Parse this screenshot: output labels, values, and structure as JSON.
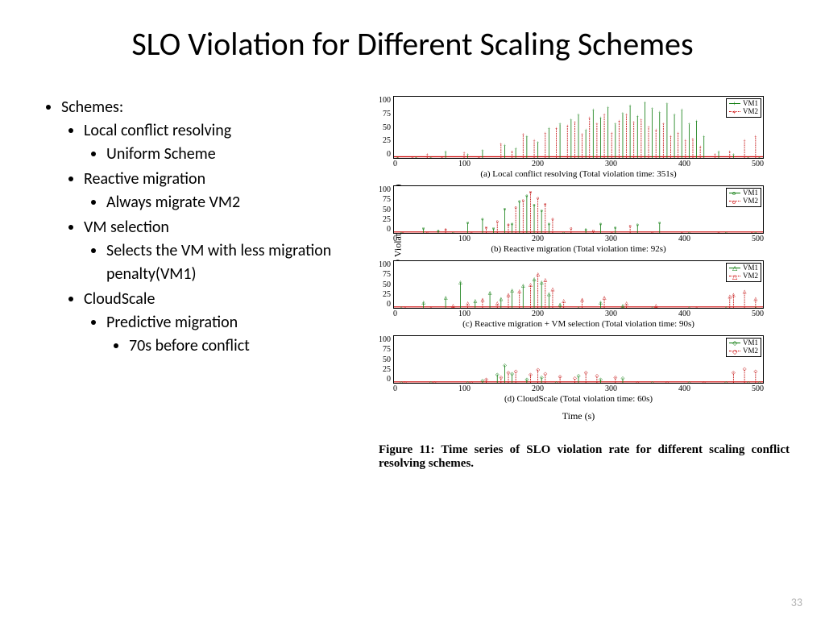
{
  "title": "SLO Violation for Different Scaling Schemes",
  "bullets": {
    "schemes_label": "Schemes:",
    "b1": "Local conflict resolving",
    "b1a": "Uniform Scheme",
    "b2": "Reactive migration",
    "b2a": "Always migrate VM2",
    "b3": "VM selection",
    "b3a": "Selects the VM with less migration penalty(VM1)",
    "b4": "CloudScale",
    "b4a": "Predictive migration",
    "b4a1": "70s before conflict"
  },
  "page_number": "33",
  "figure_caption": "Figure 11: Time series of SLO violation rate for different scaling conflict resolving schemes.",
  "axis": {
    "ylabel": "SLO Violation Rate (%)",
    "xlabel": "Time (s)",
    "xticks": [
      "0",
      "100",
      "200",
      "300",
      "400",
      "500"
    ]
  },
  "legend_labels": {
    "vm1": "VM1",
    "vm2": "VM2"
  },
  "chart_data": [
    {
      "id": "a",
      "height": "big",
      "caption": "(a) Local conflict resolving (Total violation time: 351s)",
      "yticks": [
        "100",
        "75",
        "50",
        "25",
        "0"
      ],
      "ylim": [
        0,
        100
      ],
      "xlim": [
        0,
        500
      ],
      "marker": {
        "vm1": "+",
        "vm2": "+"
      },
      "color": {
        "vm1": "#0a7a0a",
        "vm2": "#c00000"
      },
      "series": {
        "vm1": {
          "x": [
            5,
            30,
            50,
            70,
            100,
            120,
            150,
            165,
            180,
            195,
            210,
            225,
            240,
            250,
            260,
            270,
            280,
            290,
            300,
            310,
            320,
            330,
            340,
            350,
            360,
            370,
            380,
            390,
            400,
            410,
            420,
            440,
            460,
            480,
            495
          ],
          "y": [
            0,
            0,
            0,
            10,
            5,
            12,
            20,
            15,
            35,
            25,
            48,
            55,
            62,
            70,
            45,
            78,
            65,
            82,
            55,
            72,
            85,
            68,
            90,
            80,
            74,
            88,
            70,
            78,
            55,
            60,
            35,
            10,
            5,
            0,
            0
          ]
        },
        "vm2": {
          "x": [
            5,
            25,
            45,
            65,
            95,
            115,
            145,
            160,
            175,
            190,
            205,
            220,
            235,
            245,
            255,
            265,
            275,
            285,
            295,
            305,
            315,
            325,
            335,
            345,
            355,
            365,
            375,
            385,
            395,
            405,
            415,
            435,
            455,
            475,
            490
          ],
          "y": [
            0,
            0,
            5,
            0,
            8,
            0,
            22,
            10,
            38,
            28,
            40,
            48,
            52,
            58,
            38,
            65,
            55,
            70,
            40,
            60,
            70,
            58,
            62,
            50,
            45,
            55,
            35,
            40,
            28,
            30,
            18,
            5,
            10,
            28,
            35
          ]
        }
      }
    },
    {
      "id": "b",
      "height": "small",
      "caption": "(b) Reactive migration (Total violation time: 92s)",
      "yticks": [
        "100",
        "75",
        "50",
        "25",
        "0"
      ],
      "ylim": [
        0,
        100
      ],
      "xlim": [
        0,
        500
      ],
      "marker": {
        "vm1": "o",
        "vm2": "o"
      },
      "color": {
        "vm1": "#0a7a0a",
        "vm2": "#c00000"
      },
      "series": {
        "vm1": {
          "x": [
            10,
            40,
            60,
            80,
            100,
            120,
            135,
            150,
            160,
            170,
            180,
            190,
            200,
            210,
            230,
            260,
            280,
            300,
            330,
            360,
            400,
            450,
            490
          ],
          "y": [
            0,
            10,
            5,
            0,
            22,
            30,
            10,
            52,
            20,
            68,
            80,
            60,
            48,
            20,
            0,
            8,
            20,
            12,
            18,
            22,
            0,
            0,
            0
          ]
        },
        "vm2": {
          "x": [
            12,
            45,
            70,
            105,
            125,
            140,
            155,
            165,
            175,
            185,
            195,
            205,
            215,
            240,
            270,
            295,
            320,
            350,
            390,
            440,
            485
          ],
          "y": [
            0,
            0,
            8,
            0,
            12,
            25,
            18,
            55,
            70,
            88,
            75,
            62,
            30,
            10,
            5,
            0,
            15,
            0,
            0,
            0,
            0
          ]
        }
      }
    },
    {
      "id": "c",
      "height": "small",
      "caption": "(c) Reactive migration + VM selection (Total violation time: 90s)",
      "yticks": [
        "100",
        "75",
        "50",
        "25",
        "0"
      ],
      "ylim": [
        0,
        100
      ],
      "xlim": [
        0,
        500
      ],
      "marker": {
        "vm1": "△",
        "vm2": "△"
      },
      "color": {
        "vm1": "#0a7a0a",
        "vm2": "#c00000"
      },
      "series": {
        "vm1": {
          "x": [
            10,
            40,
            70,
            90,
            110,
            130,
            145,
            160,
            175,
            190,
            200,
            210,
            225,
            250,
            280,
            310,
            350,
            400,
            450,
            490
          ],
          "y": [
            0,
            12,
            22,
            55,
            15,
            33,
            20,
            38,
            48,
            62,
            55,
            30,
            8,
            0,
            12,
            5,
            0,
            0,
            0,
            0
          ]
        },
        "vm2": {
          "x": [
            15,
            50,
            80,
            100,
            120,
            140,
            155,
            170,
            185,
            195,
            205,
            215,
            230,
            255,
            285,
            315,
            355,
            410,
            455,
            460,
            475,
            490
          ],
          "y": [
            0,
            0,
            5,
            10,
            18,
            10,
            28,
            36,
            50,
            72,
            60,
            40,
            15,
            18,
            22,
            10,
            5,
            0,
            25,
            28,
            35,
            20
          ]
        }
      }
    },
    {
      "id": "d",
      "height": "small",
      "caption": "(d) CloudScale (Total violation time: 60s)",
      "yticks": [
        "100",
        "75",
        "50",
        "25",
        "0"
      ],
      "ylim": [
        0,
        100
      ],
      "xlim": [
        0,
        500
      ],
      "marker": {
        "vm1": "◇",
        "vm2": "◇"
      },
      "color": {
        "vm1": "#0a7a0a",
        "vm2": "#c00000"
      },
      "series": {
        "vm1": {
          "x": [
            10,
            50,
            100,
            120,
            140,
            150,
            160,
            180,
            200,
            220,
            250,
            280,
            310,
            350,
            400,
            450,
            480,
            495
          ],
          "y": [
            0,
            0,
            0,
            5,
            18,
            38,
            20,
            8,
            12,
            0,
            15,
            8,
            10,
            0,
            0,
            0,
            0,
            0
          ]
        },
        "vm2": {
          "x": [
            15,
            55,
            105,
            125,
            145,
            155,
            165,
            185,
            195,
            205,
            225,
            245,
            260,
            275,
            300,
            330,
            370,
            420,
            460,
            475,
            490
          ],
          "y": [
            0,
            0,
            0,
            8,
            12,
            22,
            25,
            18,
            28,
            20,
            14,
            10,
            22,
            15,
            12,
            0,
            0,
            0,
            22,
            30,
            25
          ]
        }
      }
    }
  ]
}
